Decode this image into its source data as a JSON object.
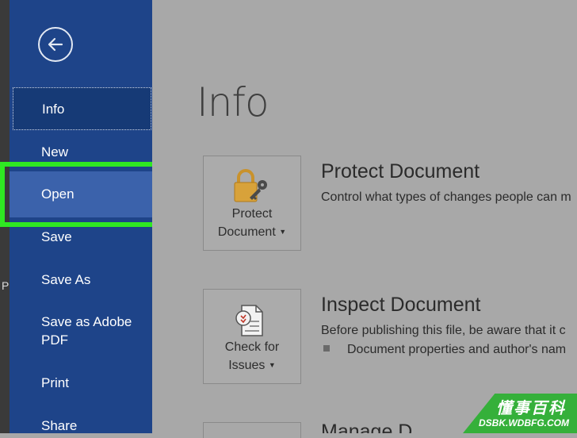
{
  "sidebar": {
    "back_label": "Back",
    "items": [
      {
        "label": "Info"
      },
      {
        "label": "New"
      },
      {
        "label": "Open"
      },
      {
        "label": "Save"
      },
      {
        "label": "Save As"
      },
      {
        "label": "Save as Adobe PDF"
      },
      {
        "label": "Print"
      },
      {
        "label": "Share"
      }
    ]
  },
  "main": {
    "title": "Info",
    "protect": {
      "tile_line1": "Protect",
      "tile_line2": "Document",
      "heading": "Protect Document",
      "description": "Control what types of changes people can m"
    },
    "inspect": {
      "tile_line1": "Check for",
      "tile_line2": "Issues",
      "heading": "Inspect Document",
      "description": "Before publishing this file, be aware that it c",
      "bullet": "Document properties and author's nam"
    },
    "manage": {
      "heading_partial": "Manage D"
    }
  },
  "left_strip": {
    "glyph": "P"
  },
  "watermark": {
    "chinese": "懂事百科",
    "url": "DSBK.WDBFG.COM"
  },
  "colors": {
    "sidebar": "#1e4489",
    "sidebar_selected": "#163a76",
    "sidebar_hover": "#3b62ab",
    "highlight": "#2fe822",
    "content_bg": "#a8a8a8",
    "watermark_bg": "#35b03a"
  }
}
